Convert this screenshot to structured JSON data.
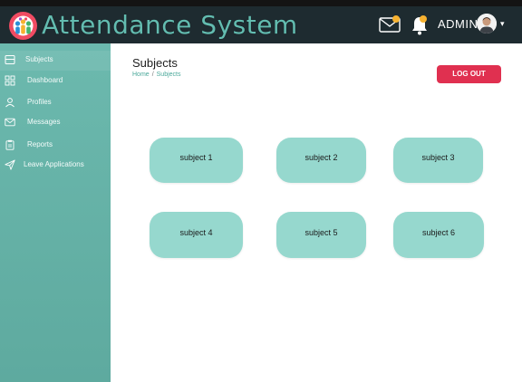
{
  "header": {
    "app_title": "Attendance System",
    "admin_label": "ADMIN",
    "mail_icon": "mail-icon",
    "bell_icon": "bell-icon",
    "caret": "▾",
    "accent": "#63bcb0",
    "badge_color": "#f7b230"
  },
  "sidebar": {
    "items": [
      {
        "label": "Subjects",
        "icon": "subjects-icon",
        "active": true
      },
      {
        "label": "Dashboard",
        "icon": "dashboard-icon"
      },
      {
        "label": "Profiles",
        "icon": "profile-icon"
      },
      {
        "label": "Messages",
        "icon": "mail-icon"
      },
      {
        "label": "Reports",
        "icon": "clipboard-icon"
      },
      {
        "label": "Leave Applications",
        "icon": "send-icon"
      }
    ]
  },
  "main": {
    "title": "Subjects",
    "breadcrumb": {
      "home": "Home",
      "separator": "/",
      "current": "Subjects"
    },
    "logout_label": "LOG OUT",
    "logout_color": "#e03050",
    "cards": [
      {
        "label": "subject 1"
      },
      {
        "label": "subject 2"
      },
      {
        "label": "subject 3"
      },
      {
        "label": "subject 4"
      },
      {
        "label": "subject 5"
      },
      {
        "label": "subject 6"
      }
    ],
    "card_color": "#96d8ce"
  }
}
